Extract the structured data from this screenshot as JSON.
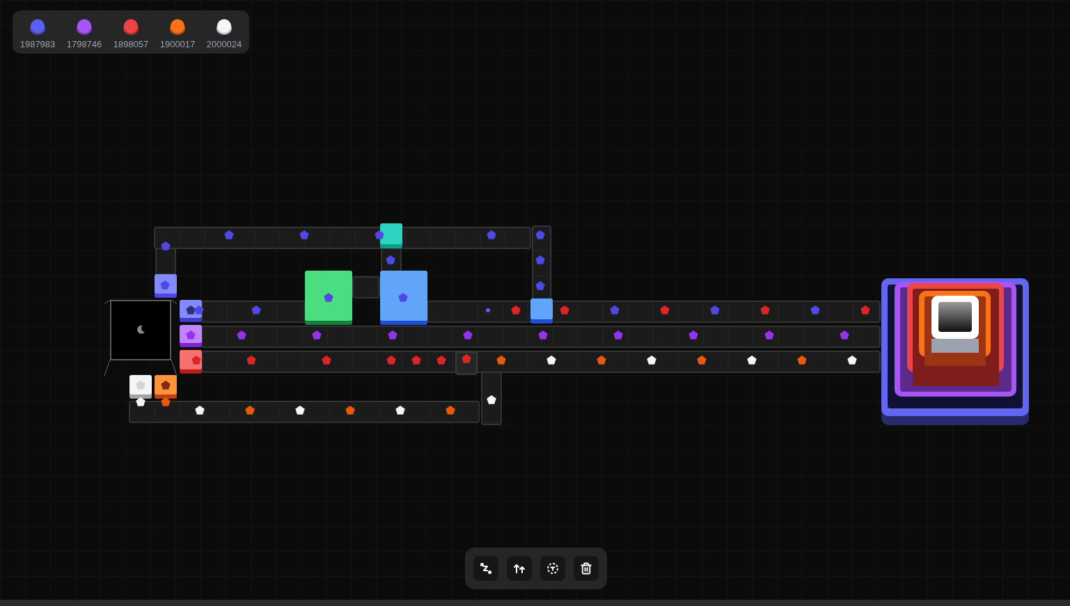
{
  "resources": [
    {
      "color": "#5b5ff0",
      "count": "1987983"
    },
    {
      "color": "#a855f7",
      "count": "1798746"
    },
    {
      "color": "#ef4444",
      "count": "1898057"
    },
    {
      "color": "#f97316",
      "count": "1900017"
    },
    {
      "color": "#f5f5f5",
      "count": "2000024"
    }
  ],
  "toolbar": [
    {
      "kind": "connect"
    },
    {
      "kind": "raise"
    },
    {
      "kind": "select"
    },
    {
      "kind": "delete"
    }
  ]
}
